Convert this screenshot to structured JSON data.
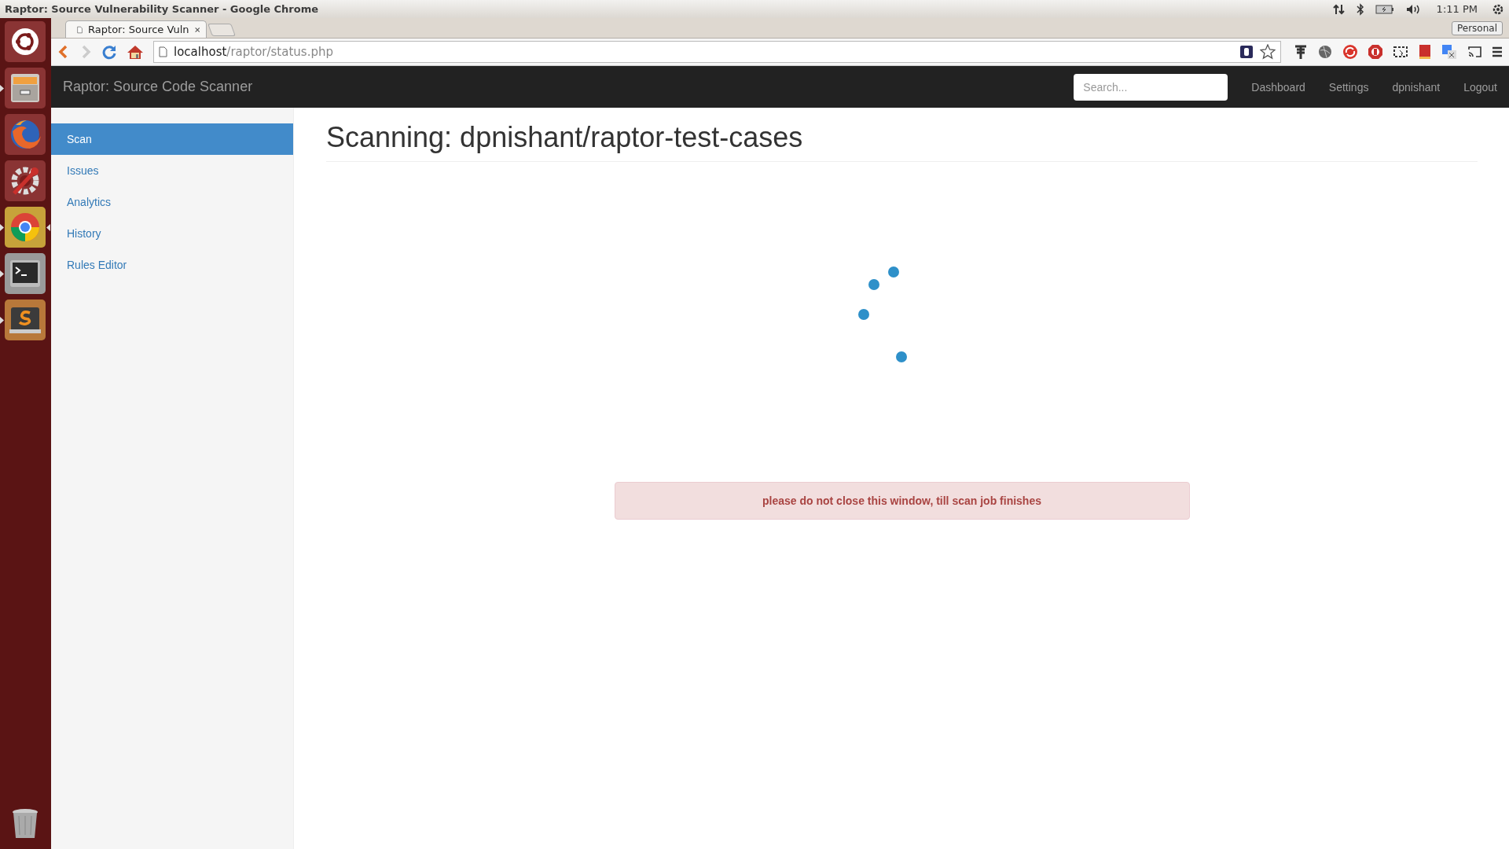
{
  "window": {
    "title": "Raptor: Source Vulnerability Scanner - Google Chrome"
  },
  "system_tray": {
    "clock": "1:11 PM"
  },
  "launcher": [
    {
      "kind": "dash",
      "running": false,
      "focused": false
    },
    {
      "kind": "files",
      "running": true,
      "focused": false
    },
    {
      "kind": "firefox",
      "running": false,
      "focused": false
    },
    {
      "kind": "settings",
      "running": false,
      "focused": false
    },
    {
      "kind": "chrome",
      "running": true,
      "focused": true
    },
    {
      "kind": "terminal",
      "running": true,
      "focused": false
    },
    {
      "kind": "editor",
      "running": true,
      "focused": false
    },
    {
      "kind": "trash",
      "running": false,
      "focused": false
    }
  ],
  "browser": {
    "tab_title": "Raptor: Source Vuln",
    "profile": "Personal",
    "url_host": "localhost",
    "url_path": "/raptor/status.php"
  },
  "navbar": {
    "brand": "Raptor: Source Code Scanner",
    "search": {
      "placeholder": "Search..."
    },
    "links": [
      "Dashboard",
      "Settings",
      "dpnishant",
      "Logout"
    ]
  },
  "sidebar": {
    "items": [
      {
        "label": "Scan",
        "selected": true
      },
      {
        "label": "Issues",
        "selected": false
      },
      {
        "label": "Analytics",
        "selected": false
      },
      {
        "label": "History",
        "selected": false
      },
      {
        "label": "Rules Editor",
        "selected": false
      }
    ]
  },
  "main": {
    "heading": "Scanning: dpnishant/raptor-test-cases",
    "alert": "please do not close this window, till scan job finishes"
  }
}
